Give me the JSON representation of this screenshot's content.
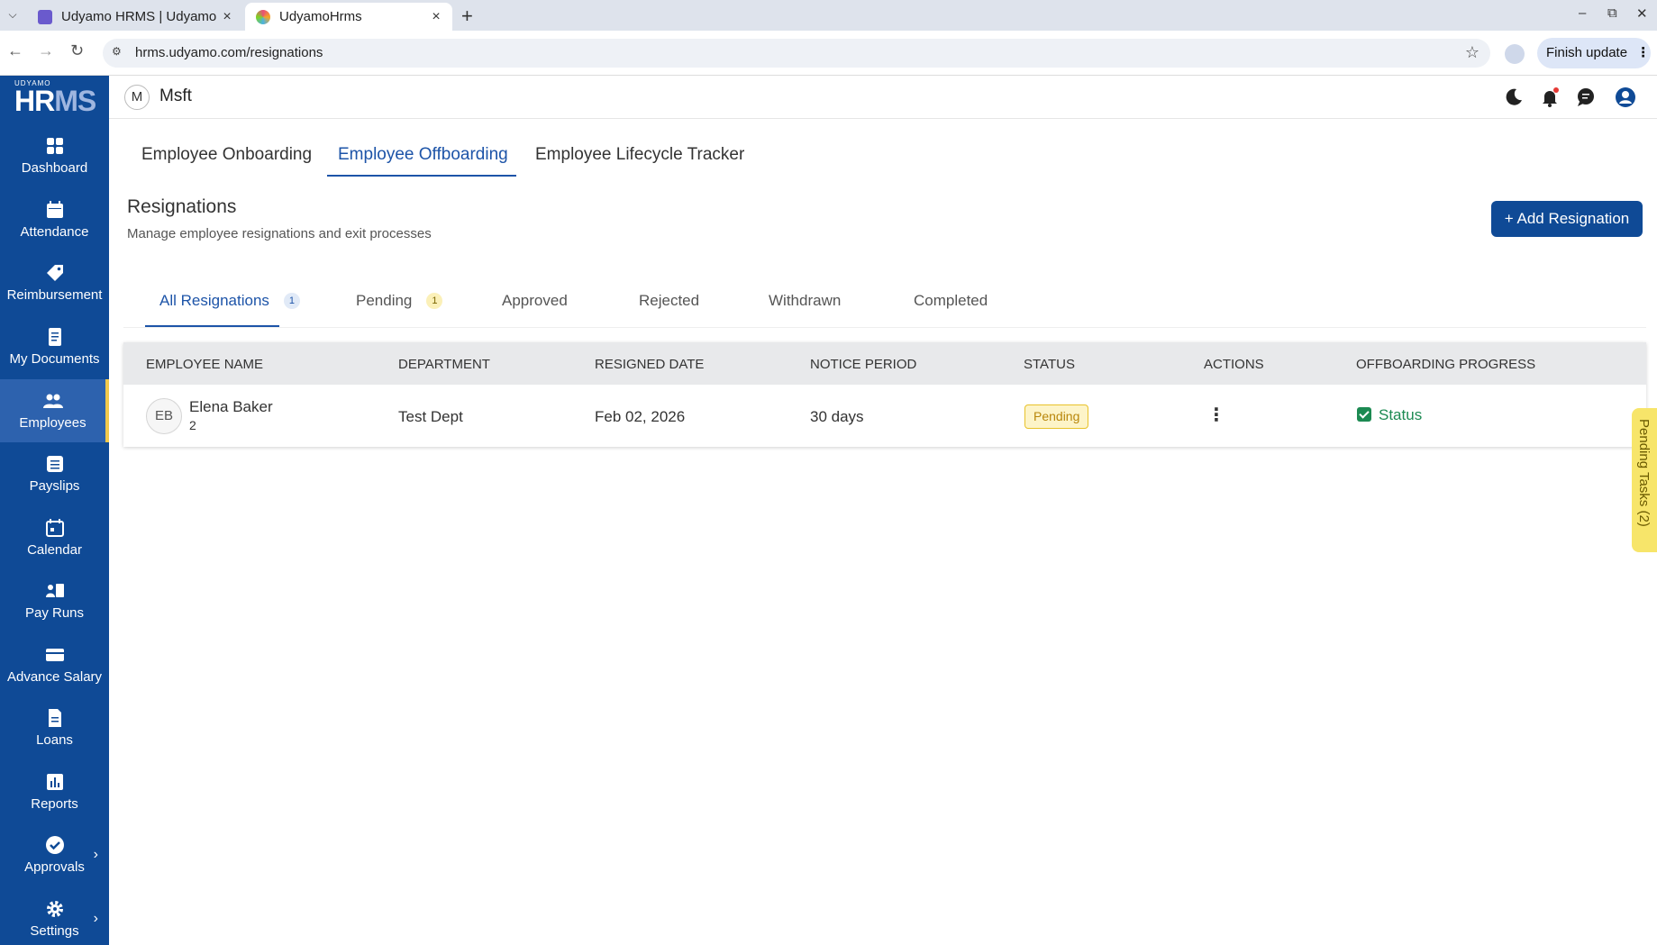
{
  "browser": {
    "tabs": [
      {
        "title": "Udyamo HRMS | Udyamo",
        "active": false
      },
      {
        "title": "UdyamoHrms",
        "active": true
      }
    ],
    "url": "hrms.udyamo.com/resignations",
    "finish_update_label": "Finish update"
  },
  "app": {
    "logo_small": "UDYAMO",
    "logo_big_a": "HR",
    "logo_big_b": "MS",
    "org_initial": "M",
    "org_name": "Msft"
  },
  "sidebar": {
    "items": [
      {
        "label": "Dashboard",
        "icon": "dashboard-icon"
      },
      {
        "label": "Attendance",
        "icon": "calendar-grid-icon"
      },
      {
        "label": "Reimbursement",
        "icon": "tag-icon"
      },
      {
        "label": "My Documents",
        "icon": "document-icon"
      },
      {
        "label": "Employees",
        "icon": "people-icon",
        "active": true
      },
      {
        "label": "Payslips",
        "icon": "payslip-icon"
      },
      {
        "label": "Calendar",
        "icon": "calendar-icon"
      },
      {
        "label": "Pay Runs",
        "icon": "pay-runs-icon"
      },
      {
        "label": "Advance Salary",
        "icon": "card-icon"
      },
      {
        "label": "Loans",
        "icon": "loan-doc-icon"
      },
      {
        "label": "Reports",
        "icon": "bar-chart-icon"
      },
      {
        "label": "Approvals",
        "icon": "check-circle-icon",
        "expandable": true
      },
      {
        "label": "Settings",
        "icon": "gear-icon",
        "expandable": true
      }
    ]
  },
  "main_tabs": [
    {
      "label": "Employee Onboarding"
    },
    {
      "label": "Employee Offboarding",
      "active": true
    },
    {
      "label": "Employee Lifecycle Tracker"
    }
  ],
  "page": {
    "title": "Resignations",
    "subtitle": "Manage employee resignations and exit processes",
    "add_button": "+ Add Resignation"
  },
  "filter_tabs": [
    {
      "label": "All Resignations",
      "count": "1",
      "active": true
    },
    {
      "label": "Pending",
      "count": "1"
    },
    {
      "label": "Approved"
    },
    {
      "label": "Rejected"
    },
    {
      "label": "Withdrawn"
    },
    {
      "label": "Completed"
    }
  ],
  "table": {
    "columns": [
      "EMPLOYEE NAME",
      "DEPARTMENT",
      "RESIGNED DATE",
      "NOTICE PERIOD",
      "STATUS",
      "ACTIONS",
      "OFFBOARDING PROGRESS"
    ],
    "rows": [
      {
        "initials": "EB",
        "name": "Elena Baker",
        "emp_id": "2",
        "department": "Test Dept",
        "resigned_date": "Feb 02, 2026",
        "notice_period": "30 days",
        "status": "Pending",
        "progress_label": "Status"
      }
    ]
  },
  "pending_tasks_label": "Pending Tasks (2)",
  "colors": {
    "sidebar_bg": "#0f4a96",
    "accent": "#1d54a8",
    "pending_yellow": "#f7e56a",
    "status_green": "#1c8a52"
  }
}
